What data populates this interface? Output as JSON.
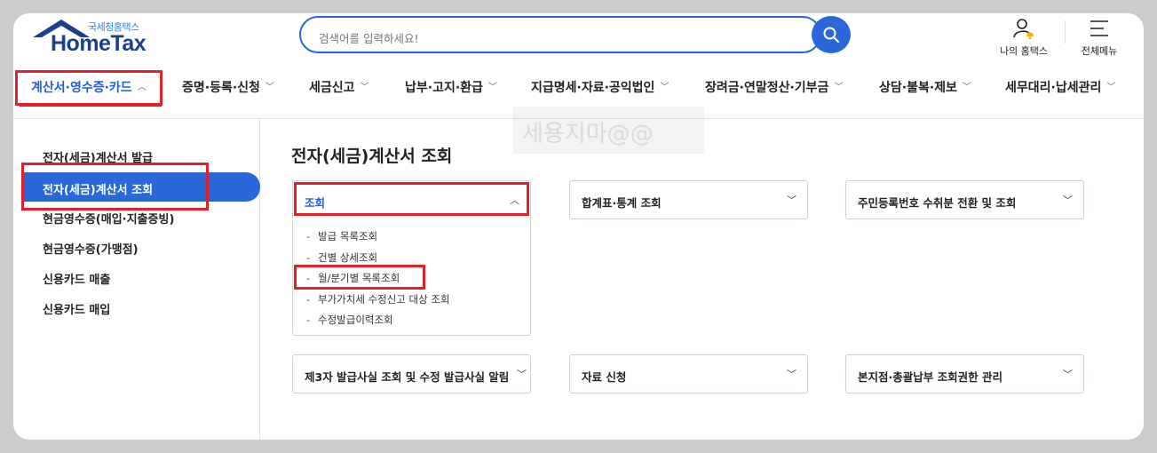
{
  "logo": {
    "sub": "국세청홈택스",
    "main": "HomeTax"
  },
  "search": {
    "placeholder": "검색어를 입력하세요!"
  },
  "utility": {
    "my_hometax": "나의 홈택스",
    "all_menu": "전체메뉴"
  },
  "gnb": [
    {
      "label": "계산서·영수증·카드",
      "chevron": "︿"
    },
    {
      "label": "증명·등록·신청",
      "chevron": "﹀"
    },
    {
      "label": "세금신고",
      "chevron": "﹀"
    },
    {
      "label": "납부·고지·환급",
      "chevron": "﹀"
    },
    {
      "label": "지급명세·자료·공익법인",
      "chevron": "﹀"
    },
    {
      "label": "장려금·연말정산·기부금",
      "chevron": "﹀"
    },
    {
      "label": "상담·불복·제보",
      "chevron": "﹀"
    },
    {
      "label": "세무대리·납세관리",
      "chevron": "﹀"
    }
  ],
  "watermark": "세용지마@@",
  "sidebar": {
    "items": [
      "전자(세금)계산서 발급",
      "전자(세금)계산서 조회",
      "현금영수증(매입·지출증빙)",
      "현금영수증(가맹점)",
      "신용카드 매출",
      "신용카드 매입"
    ]
  },
  "content": {
    "title": "전자(세금)계산서 조회",
    "cards": [
      {
        "label": "조회",
        "chevron": "︿"
      },
      {
        "label": "합계표·통계 조회",
        "chevron": "﹀"
      },
      {
        "label": "주민등록번호 수취분 전환 및 조회",
        "chevron": "﹀"
      },
      {
        "label": "제3자 발급사실 조회 및 수정 발급사실 알림",
        "chevron": "﹀"
      },
      {
        "label": "자료 신청",
        "chevron": "﹀"
      },
      {
        "label": "본지점·총괄납부 조회권한 관리",
        "chevron": "﹀"
      }
    ],
    "sub_items": [
      "발급 목록조회",
      "건별 상세조회",
      "월/분기별 목록조회",
      "부가가치세 수정신고 대상 조회",
      "수정발급이력조회"
    ]
  },
  "colors": {
    "accent": "#2a68d9",
    "highlight_box": "#e0202a",
    "logo": "#1a3f8f"
  },
  "icons": [
    "house-roof-icon",
    "search-icon",
    "person-bell-icon",
    "hamburger-menu-icon",
    "chevron-up-icon",
    "chevron-down-icon"
  ]
}
